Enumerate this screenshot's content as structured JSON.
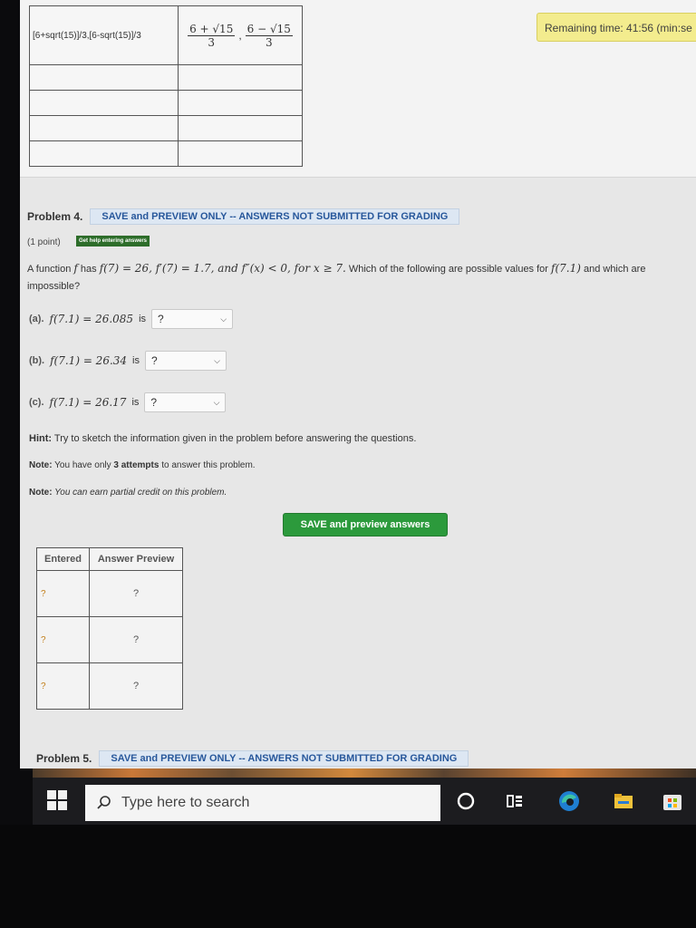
{
  "timer": {
    "text": "Remaining time: 41:56 (min:se"
  },
  "prev_table": {
    "entered": "[6+sqrt(15)]/3,[6-sqrt(15)]/3",
    "preview": {
      "a_num": "6 + √15",
      "a_den": "3",
      "sep": ",",
      "b_num": "6 − √15",
      "b_den": "3"
    }
  },
  "problem4": {
    "title": "Problem 4.",
    "banner": "SAVE and PREVIEW ONLY -- ANSWERS NOT SUBMITTED FOR GRADING",
    "points": "(1 point)",
    "help_button": "Get help entering answers",
    "statement_pre": "A function ",
    "statement_f": "f",
    "statement_has": " has ",
    "statement_math": "f(7) = 26, f′(7) = 1.7, and f″(x) < 0, for x ≥ 7.",
    "statement_post": " Which of the following are possible values for ",
    "statement_target": "f(7.1)",
    "statement_end": " and which are impossible?",
    "parts": [
      {
        "label": "(a).",
        "expr": "f(7.1) = 26.085",
        "is": "is",
        "selected": "?"
      },
      {
        "label": "(b).",
        "expr": "f(7.1) = 26.34",
        "is": "is",
        "selected": "?"
      },
      {
        "label": "(c).",
        "expr": "f(7.1) = 26.17",
        "is": "is",
        "selected": "?"
      }
    ],
    "hint_label": "Hint:",
    "hint_text": " Try to sketch the information given in the problem before answering the questions.",
    "note1_label": "Note:",
    "note1_pre": " You have only ",
    "note1_bold": "3 attempts",
    "note1_post": " to answer this problem.",
    "note2_label": "Note:",
    "note2_text": " You can earn partial credit on this problem.",
    "save_button": "SAVE and preview answers",
    "answers_table": {
      "headers": [
        "Entered",
        "Answer Preview"
      ],
      "rows": [
        {
          "entered": "?",
          "preview": "?"
        },
        {
          "entered": "?",
          "preview": "?"
        },
        {
          "entered": "?",
          "preview": "?"
        }
      ]
    }
  },
  "problem5": {
    "title": "Problem 5.",
    "banner": "SAVE and PREVIEW ONLY -- ANSWERS NOT SUBMITTED FOR GRADING"
  },
  "taskbar": {
    "search_placeholder": "Type here to search",
    "icons": [
      "windows-start-icon",
      "search-icon",
      "cortana-icon",
      "task-view-icon",
      "edge-icon",
      "file-explorer-icon",
      "store-icon"
    ]
  }
}
